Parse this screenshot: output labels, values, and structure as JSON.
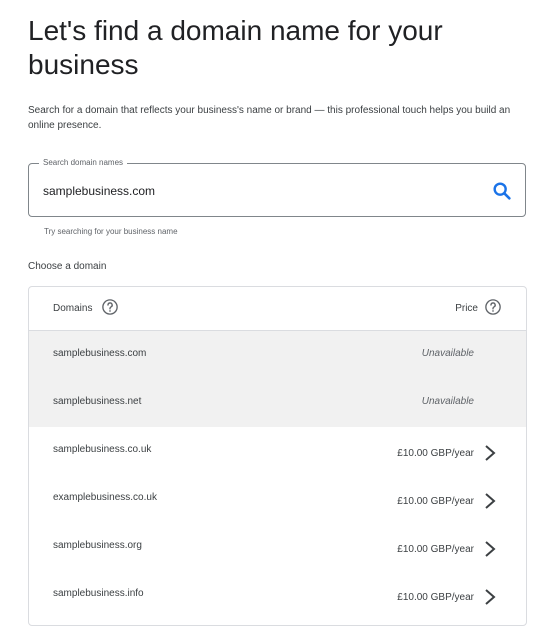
{
  "header": {
    "title": "Let's find a domain name for your business",
    "subtitle": "Search for a domain that reflects your business's name or brand — this professional touch helps you build an online presence."
  },
  "search": {
    "label": "Search domain names",
    "value": "samplebusiness.com",
    "helper": "Try searching for your business name",
    "icon": "search-icon"
  },
  "section_label": "Choose a domain",
  "table": {
    "col_domains": "Domains",
    "col_price": "Price",
    "help_icon": "help-circle-icon",
    "rows": [
      {
        "domain": "samplebusiness.com",
        "status": "Unavailable",
        "price": ""
      },
      {
        "domain": "samplebusiness.net",
        "status": "Unavailable",
        "price": ""
      },
      {
        "domain": "samplebusiness.co.uk",
        "status": "",
        "price": "£10.00 GBP/year"
      },
      {
        "domain": "examplebusiness.co.uk",
        "status": "",
        "price": "£10.00 GBP/year"
      },
      {
        "domain": "samplebusiness.org",
        "status": "",
        "price": "£10.00 GBP/year"
      },
      {
        "domain": "samplebusiness.info",
        "status": "",
        "price": "£10.00 GBP/year"
      }
    ]
  },
  "colors": {
    "accent": "#1a73e8",
    "unavailable_bg": "#f1f1f1",
    "border": "#dadce0"
  }
}
